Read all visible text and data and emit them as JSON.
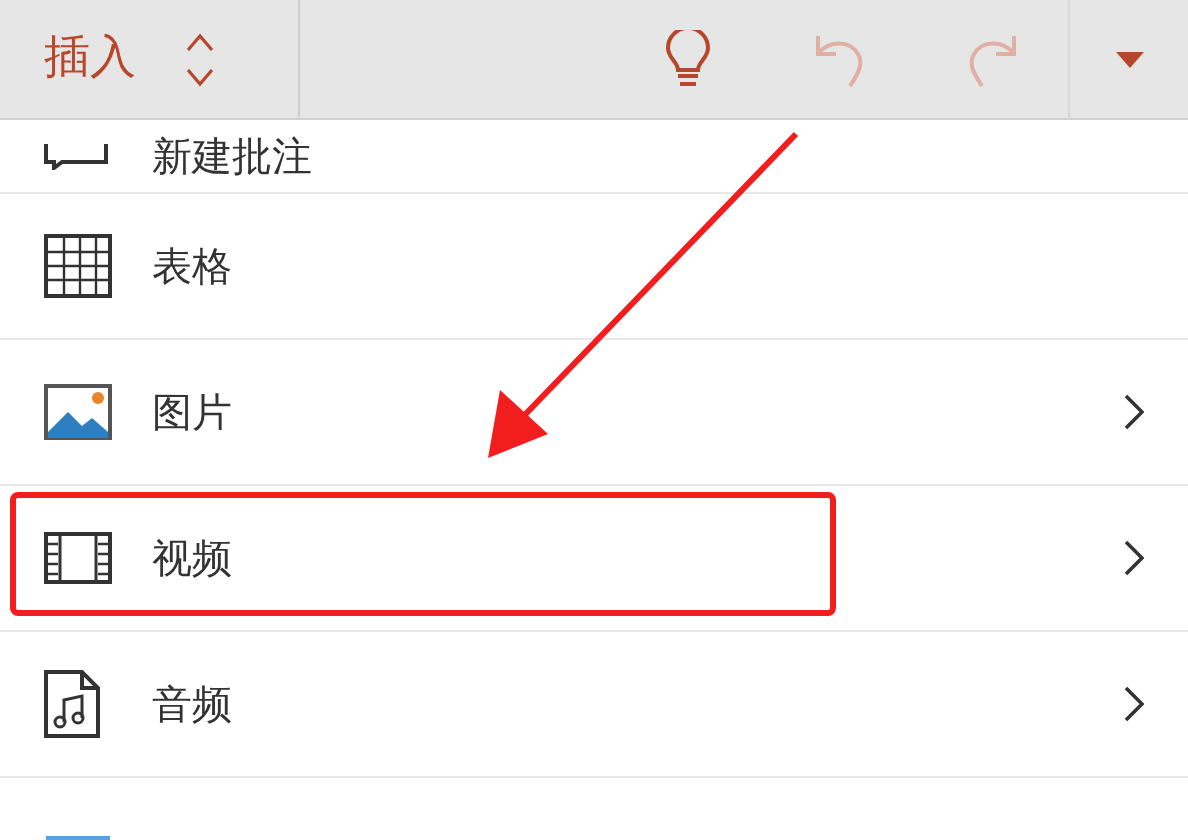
{
  "toolbar": {
    "title": "插入",
    "buttons": [
      {
        "kind": "lightbulb",
        "disabled": false
      },
      {
        "kind": "undo",
        "disabled": true
      },
      {
        "kind": "redo",
        "disabled": true
      },
      {
        "kind": "dropdown",
        "disabled": false
      }
    ]
  },
  "items": [
    {
      "kind": "comment",
      "label": "新建批注",
      "has_submenu": false,
      "highlighted": false
    },
    {
      "kind": "table",
      "label": "表格",
      "has_submenu": false,
      "highlighted": false
    },
    {
      "kind": "picture",
      "label": "图片",
      "has_submenu": true,
      "highlighted": false
    },
    {
      "kind": "video",
      "label": "视频",
      "has_submenu": true,
      "highlighted": true
    },
    {
      "kind": "audio",
      "label": "音频",
      "has_submenu": true,
      "highlighted": false
    },
    {
      "kind": "partial",
      "has_submenu": false,
      "highlighted": false
    }
  ]
}
